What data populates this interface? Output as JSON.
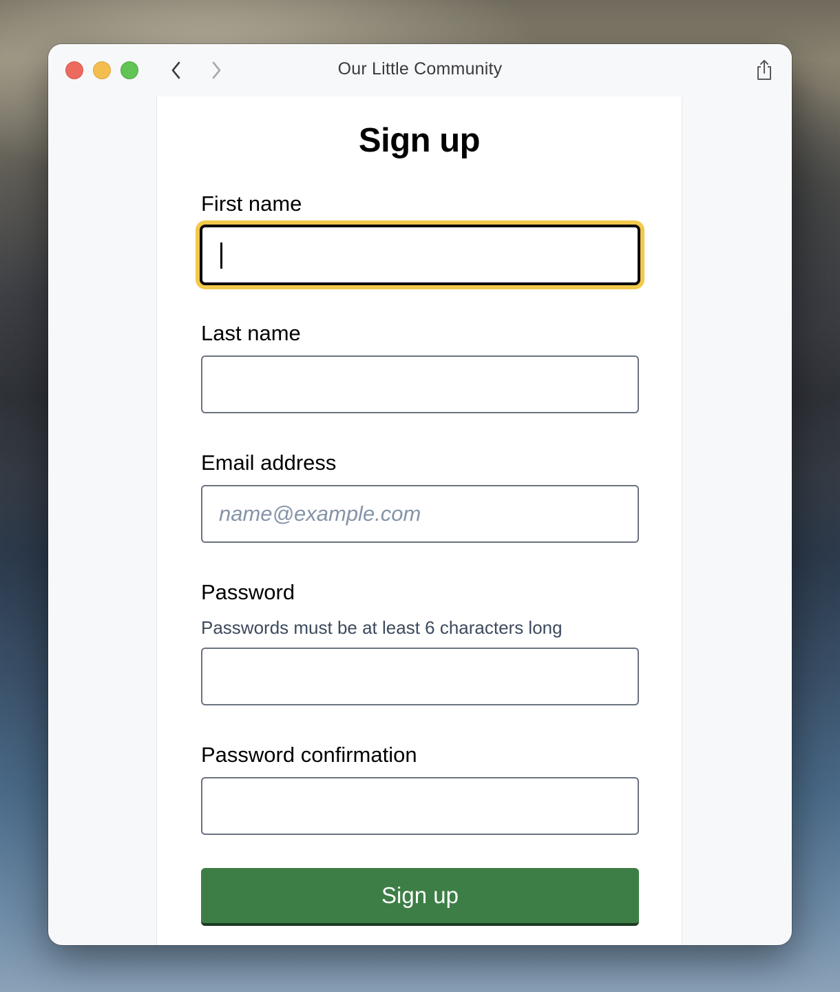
{
  "window": {
    "title": "Our Little Community"
  },
  "icons": {
    "back": "chevron-left-icon",
    "forward": "chevron-right-icon",
    "share": "share-icon"
  },
  "form": {
    "heading": "Sign up",
    "first_name": {
      "label": "First name",
      "value": "",
      "placeholder": ""
    },
    "last_name": {
      "label": "Last name",
      "value": "",
      "placeholder": ""
    },
    "email": {
      "label": "Email address",
      "value": "",
      "placeholder": "name@example.com"
    },
    "password": {
      "label": "Password",
      "hint": "Passwords must be at least 6 characters long",
      "value": ""
    },
    "password_confirmation": {
      "label": "Password confirmation",
      "value": ""
    },
    "submit_label": "Sign up"
  },
  "colors": {
    "focus_ring": "#f2c94c",
    "submit_bg": "#3d7e46",
    "close": "#ed6a5e",
    "minimize": "#f4be4f",
    "maximize": "#61c454"
  }
}
